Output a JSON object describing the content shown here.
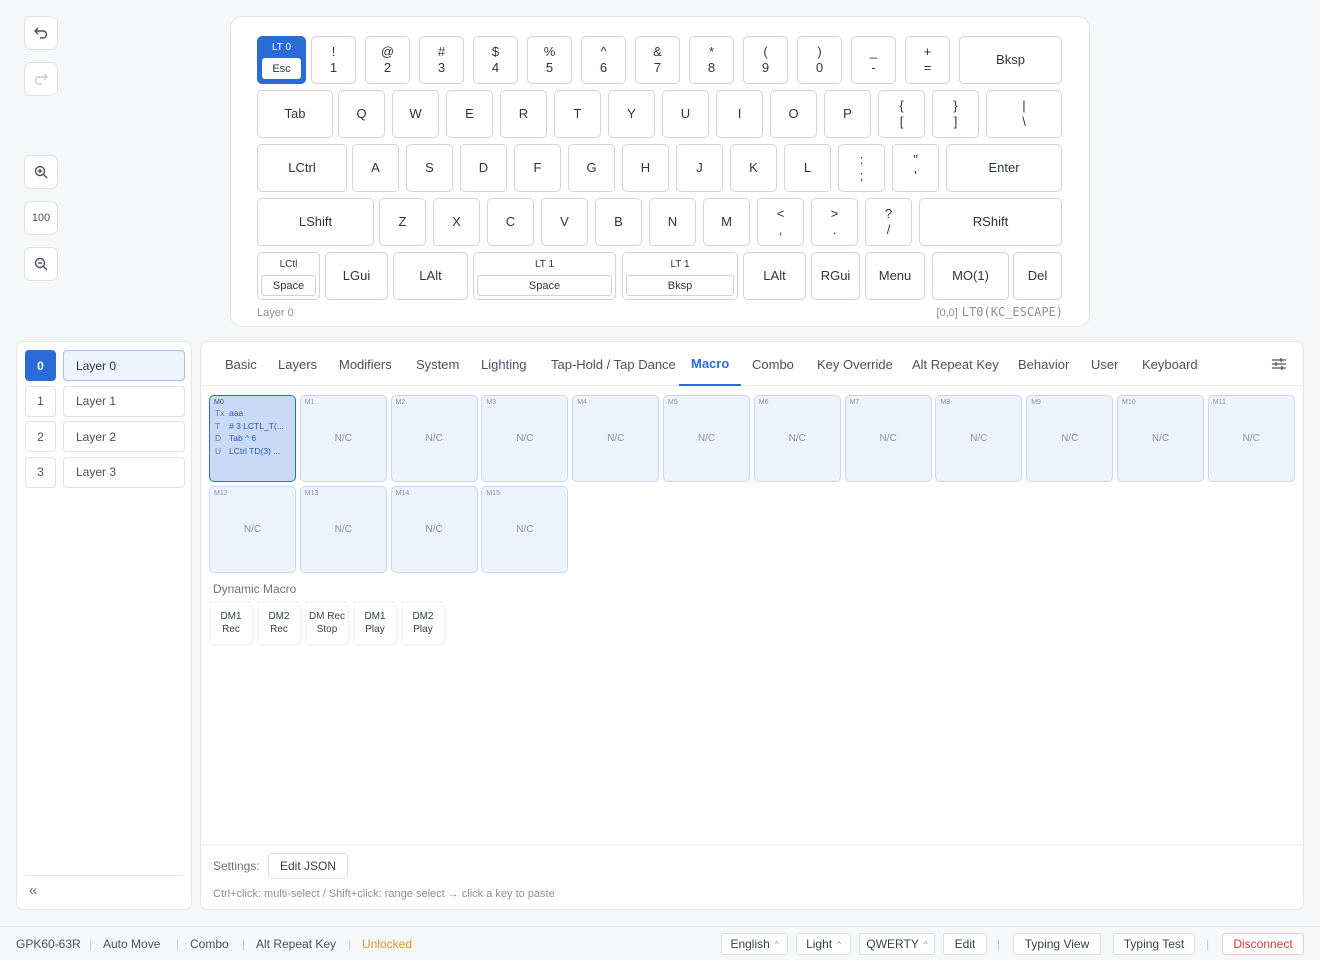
{
  "tools": {
    "zoom_value": "100"
  },
  "keyboard": {
    "selected_key": {
      "lt": "LT 0",
      "label": "Esc"
    },
    "row1": [
      {
        "top": "!",
        "bot": "1"
      },
      {
        "top": "@",
        "bot": "2"
      },
      {
        "top": "#",
        "bot": "3"
      },
      {
        "top": "$",
        "bot": "4"
      },
      {
        "top": "%",
        "bot": "5"
      },
      {
        "top": "^",
        "bot": "6"
      },
      {
        "top": "&",
        "bot": "7"
      },
      {
        "top": "*",
        "bot": "8"
      },
      {
        "top": "(",
        "bot": "9"
      },
      {
        "top": ")",
        "bot": "0"
      },
      {
        "top": "_",
        "bot": "-"
      },
      {
        "top": "+",
        "bot": "="
      },
      {
        "label": "Bksp"
      }
    ],
    "row2": [
      {
        "label": "Tab"
      },
      {
        "label": "Q"
      },
      {
        "label": "W"
      },
      {
        "label": "E"
      },
      {
        "label": "R"
      },
      {
        "label": "T"
      },
      {
        "label": "Y"
      },
      {
        "label": "U"
      },
      {
        "label": "I"
      },
      {
        "label": "O"
      },
      {
        "label": "P"
      },
      {
        "top": "{",
        "bot": "["
      },
      {
        "top": "}",
        "bot": "]"
      },
      {
        "top": "|",
        "bot": "\\"
      }
    ],
    "row3": [
      {
        "label": "LCtrl"
      },
      {
        "label": "A"
      },
      {
        "label": "S"
      },
      {
        "label": "D"
      },
      {
        "label": "F"
      },
      {
        "label": "G"
      },
      {
        "label": "H"
      },
      {
        "label": "J"
      },
      {
        "label": "K"
      },
      {
        "label": "L"
      },
      {
        "top": ":",
        "bot": ";"
      },
      {
        "top": "\"",
        "bot": "'"
      },
      {
        "label": "Enter"
      }
    ],
    "row4": [
      {
        "label": "LShift"
      },
      {
        "label": "Z"
      },
      {
        "label": "X"
      },
      {
        "label": "C"
      },
      {
        "label": "V"
      },
      {
        "label": "B"
      },
      {
        "label": "N"
      },
      {
        "label": "M"
      },
      {
        "top": "<",
        "bot": ","
      },
      {
        "top": ">",
        "bot": "."
      },
      {
        "top": "?",
        "bot": "/"
      },
      {
        "label": "RShift"
      }
    ],
    "row5": [
      {
        "lt": "LCtl",
        "label": "Space"
      },
      {
        "label": "LGui"
      },
      {
        "label": "LAlt"
      },
      {
        "lt": "LT 1",
        "label": "Space"
      },
      {
        "lt": "LT 1",
        "label": "Bksp"
      },
      {
        "label": "LAlt"
      },
      {
        "label": "RGui"
      },
      {
        "label": "Menu"
      },
      {
        "label": "MO(1)"
      },
      {
        "label": "Del"
      }
    ],
    "layer_label": "Layer 0",
    "key_position": "[0,0]",
    "keycode": "LT0(KC_ESCAPE)"
  },
  "layers": [
    {
      "num": "0",
      "name": "Layer 0"
    },
    {
      "num": "1",
      "name": "Layer 1"
    },
    {
      "num": "2",
      "name": "Layer 2"
    },
    {
      "num": "3",
      "name": "Layer 3"
    }
  ],
  "collapse_label": "«",
  "tabs": [
    "Basic",
    "Layers",
    "Modifiers",
    "System",
    "Lighting",
    "Tap-Hold / Tap Dance",
    "Macro",
    "Combo",
    "Key Override",
    "Alt Repeat Key",
    "Behavior",
    "User",
    "Keyboard"
  ],
  "active_tab": "Macro",
  "macros": {
    "m0": {
      "id": "M0",
      "lines": [
        {
          "prefix": "Tx",
          "text": "aaa"
        },
        {
          "prefix": "T",
          "text": "# 3 LCTL_T(..."
        },
        {
          "prefix": "D",
          "text": "Tab ^ 6"
        },
        {
          "prefix": "U",
          "text": "LCtrl TD(3) ..."
        }
      ]
    },
    "others": [
      {
        "id": "M1",
        "value": "N/C"
      },
      {
        "id": "M2",
        "value": "N/C"
      },
      {
        "id": "M3",
        "value": "N/C"
      },
      {
        "id": "M4",
        "value": "N/C"
      },
      {
        "id": "M5",
        "value": "N/C"
      },
      {
        "id": "M6",
        "value": "N/C"
      },
      {
        "id": "M7",
        "value": "N/C"
      },
      {
        "id": "M8",
        "value": "N/C"
      },
      {
        "id": "M9",
        "value": "N/C"
      },
      {
        "id": "M10",
        "value": "N/C"
      },
      {
        "id": "M11",
        "value": "N/C"
      },
      {
        "id": "M12",
        "value": "N/C"
      },
      {
        "id": "M13",
        "value": "N/C"
      },
      {
        "id": "M14",
        "value": "N/C"
      },
      {
        "id": "M15",
        "value": "N/C"
      }
    ]
  },
  "dynamic_macro": {
    "title": "Dynamic Macro",
    "buttons": [
      {
        "l1": "DM1",
        "l2": "Rec"
      },
      {
        "l1": "DM2",
        "l2": "Rec"
      },
      {
        "l1": "DM Rec",
        "l2": "Stop"
      },
      {
        "l1": "DM1",
        "l2": "Play"
      },
      {
        "l1": "DM2",
        "l2": "Play"
      }
    ]
  },
  "settings": {
    "label": "Settings:",
    "edit_json": "Edit JSON",
    "hint": "Ctrl+click: multi-select / Shift+click: range select → click a key to paste"
  },
  "status": {
    "device": "GPK60-63R",
    "auto_move": "Auto Move",
    "combo": "Combo",
    "alt_repeat": "Alt Repeat Key",
    "lock_state": "Unlocked",
    "language": "English",
    "theme": "Light",
    "layout": "QWERTY",
    "edit": "Edit",
    "typing_view": "Typing View",
    "typing_test": "Typing Test",
    "disconnect": "Disconnect"
  },
  "colors": {
    "accent": "#2b6bd8",
    "warning": "#d99a1e",
    "danger": "#d63a3a"
  }
}
